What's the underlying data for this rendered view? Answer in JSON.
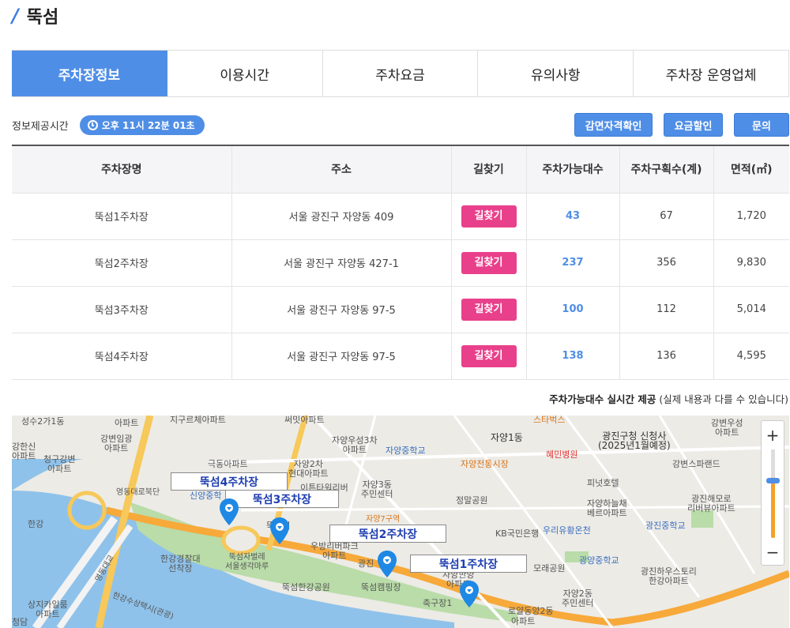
{
  "header": {
    "slash": "/",
    "title": "뚝섬"
  },
  "tabs": [
    {
      "label": "주차장정보",
      "active": true
    },
    {
      "label": "이용시간"
    },
    {
      "label": "주차요금"
    },
    {
      "label": "유의사항"
    },
    {
      "label": "주차장 운영업체"
    }
  ],
  "info": {
    "label": "정보제공시간",
    "time": "오후 11시 22분 01초",
    "buttons": [
      "감면자격확인",
      "요금할인",
      "문의"
    ]
  },
  "table": {
    "headers": [
      "주차장명",
      "주소",
      "길찾기",
      "주차가능대수",
      "주차구획수(계)",
      "면적(㎡)"
    ],
    "find_label": "길찾기",
    "rows": [
      {
        "name": "뚝섬1주차장",
        "address": "서울 광진구 자양동 409",
        "available": "43",
        "spaces": "67",
        "area": "1,720"
      },
      {
        "name": "뚝섬2주차장",
        "address": "서울 광진구 자양동 427-1",
        "available": "237",
        "spaces": "356",
        "area": "9,830"
      },
      {
        "name": "뚝섬3주차장",
        "address": "서울 광진구 자양동 97-5",
        "available": "100",
        "spaces": "112",
        "area": "5,014"
      },
      {
        "name": "뚝섬4주차장",
        "address": "서울 광진구 자양동 97-5",
        "available": "138",
        "spaces": "136",
        "area": "4,595"
      }
    ]
  },
  "note": {
    "bold": "주차가능대수 실시간 제공",
    "rest": " (실제 내용과 다를 수 있습니다)"
  },
  "map": {
    "callouts": [
      "뚝섬4주차장",
      "뚝섬3주차장",
      "뚝섬2주차장",
      "뚝섬1주차장"
    ],
    "zoom_in": "+",
    "zoom_out": "−",
    "labels": {
      "l1": "성수2가1동",
      "l2": "강변임광\n아파트",
      "l3": "강한신\n아파트",
      "l4": "청구강변\n아파트",
      "l5": "극동아파트",
      "l6": "자양2차\n현대아파트",
      "l7": "이튼타워리버\n아파트",
      "l8": "자양우성3차\n아파트",
      "l9": "자양중학교",
      "l10": "자양1동",
      "l11": "자양전통시장",
      "l12": "혜민병원",
      "l13": "광진구청 신청사\n(2025년1월예정)",
      "l14": "강변스파랜드",
      "l15": "강변우성\n아파트",
      "l16": "스타벅스",
      "l17": "영동대로북단",
      "l18": "신양중학",
      "l19": "자양3동\n주민센터",
      "l20": "정말공원",
      "l21": "피넛호텔",
      "l22": "자양하늘채\n베르아파트",
      "l23": "광진해모로\n리버뷰아파트",
      "l24": "광진중학교",
      "l25": "자양7구역",
      "l26": "KB국민은행",
      "l27": "우리유황온천",
      "l28": "우방리버파크\n아파트",
      "l29": "한강경찰대\n선착장",
      "l30": "뚝섬자벌레\n서울생각마루",
      "l31": "뚝섬한강공원",
      "l32": "뚝섬캠핑장",
      "l33": "광진",
      "l34": "광양중학교",
      "l35": "광진하우스토리\n한강아파트",
      "l36": "모래공원",
      "l37": "자양2동\n주민센터",
      "l38": "로얄동양2동",
      "l39": "아파트",
      "l40": "축구장1",
      "l41": "상지카일룸\n아파트",
      "l42": "한강",
      "l43": "청담",
      "l44": "영동대교",
      "l45": "한강수상택시(관광)",
      "l46": "써밋아파트",
      "l47": "지구르체아파트",
      "l48": "뚝섬역",
      "l49": "자양한양\n아파트",
      "l50": "아파트"
    }
  }
}
